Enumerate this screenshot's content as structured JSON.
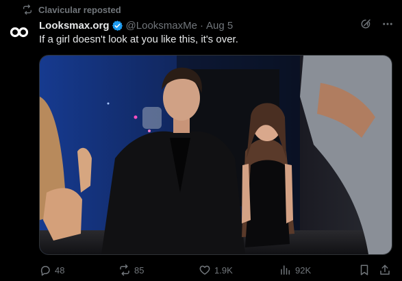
{
  "repost": {
    "text": "Clavicular reposted"
  },
  "post": {
    "author_name": "Looksmax.org",
    "handle": "@LooksmaxMe",
    "separator": "·",
    "date": "Aug 5",
    "text": "If a girl doesn't look at you like this, it's over.",
    "media_alt": "Photo of a man in a black suit seated in a dark club while a woman beside him looks up at him"
  },
  "actions": {
    "replies": "48",
    "reposts": "85",
    "likes": "1.9K",
    "views": "92K"
  },
  "colors": {
    "background": "#000000",
    "text_primary": "#e7e9ea",
    "text_secondary": "#71767b",
    "verified_badge": "#1d9bf0",
    "border": "#2f3336"
  },
  "icons": {
    "repost_indicator": "repost-icon",
    "avatar": "looksmax-logo-icon",
    "verified": "verified-badge-icon",
    "grok": "grok-icon",
    "more": "more-options-icon",
    "reply": "reply-icon",
    "repost": "repost-icon",
    "like": "like-icon",
    "views": "views-icon",
    "bookmark": "bookmark-icon",
    "share": "share-icon"
  }
}
